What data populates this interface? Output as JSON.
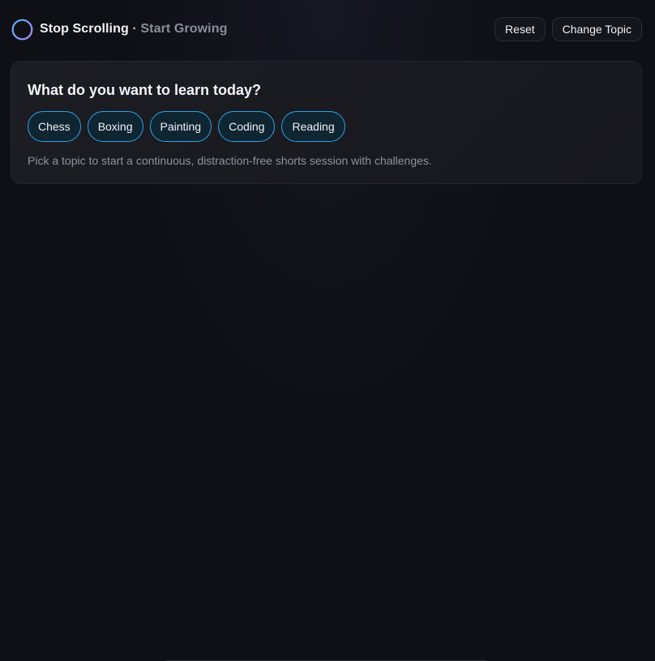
{
  "header": {
    "brand_main": "Stop Scrolling",
    "brand_sep": " · ",
    "brand_sub": "Start Growing",
    "logo_icon": "plus-circle-icon",
    "reset_label": "Reset",
    "change_topic_label": "Change Topic"
  },
  "card": {
    "title": "What do you want to learn today?",
    "topics": [
      "Chess",
      "Boxing",
      "Painting",
      "Coding",
      "Reading"
    ],
    "hint": "Pick a topic to start a continuous, distraction-free shorts session with challenges."
  },
  "colors": {
    "background": "#0f1015",
    "card": "#1b1c22",
    "chip_border": "#2aa3e6",
    "logo_gradient_start": "#4fb6ff",
    "logo_gradient_end": "#b68cff"
  }
}
